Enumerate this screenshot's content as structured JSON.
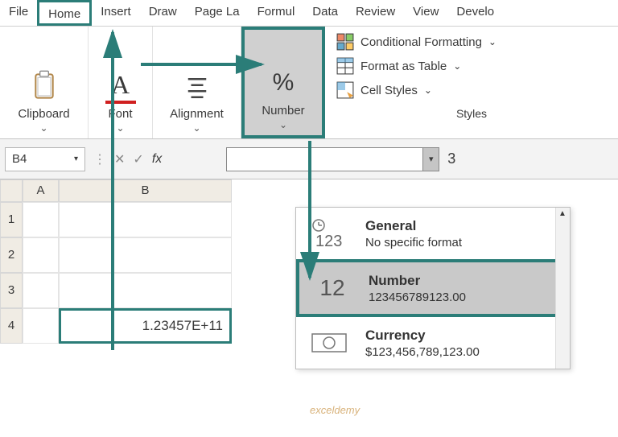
{
  "tabs": {
    "file": "File",
    "home": "Home",
    "insert": "Insert",
    "draw": "Draw",
    "pagelayout": "Page La",
    "formulas": "Formul",
    "data": "Data",
    "review": "Review",
    "view": "View",
    "developer": "Develo"
  },
  "ribbon": {
    "clipboard": "Clipboard",
    "font": "Font",
    "alignment": "Alignment",
    "number": "Number",
    "cond_fmt": "Conditional Formatting",
    "fmt_table": "Format as Table",
    "cell_styles": "Cell Styles",
    "styles_label": "Styles",
    "percent_glyph": "%",
    "font_glyph": "A"
  },
  "formula_bar": {
    "namebox": "B4",
    "fx": "fx",
    "check": "✓",
    "cross": "✕",
    "extra": "3"
  },
  "grid": {
    "colA": "A",
    "colB": "B",
    "rows": [
      "1",
      "2",
      "3",
      "4"
    ],
    "b4_value": "1.23457E+11"
  },
  "dropdown": {
    "general": {
      "title": "General",
      "sub": "No specific format",
      "icon": "123"
    },
    "number": {
      "title": "Number",
      "sub": "123456789123.00",
      "icon": "12"
    },
    "currency": {
      "title": "Currency",
      "sub": "$123,456,789,123.00"
    }
  },
  "watermark": "exceldemy"
}
